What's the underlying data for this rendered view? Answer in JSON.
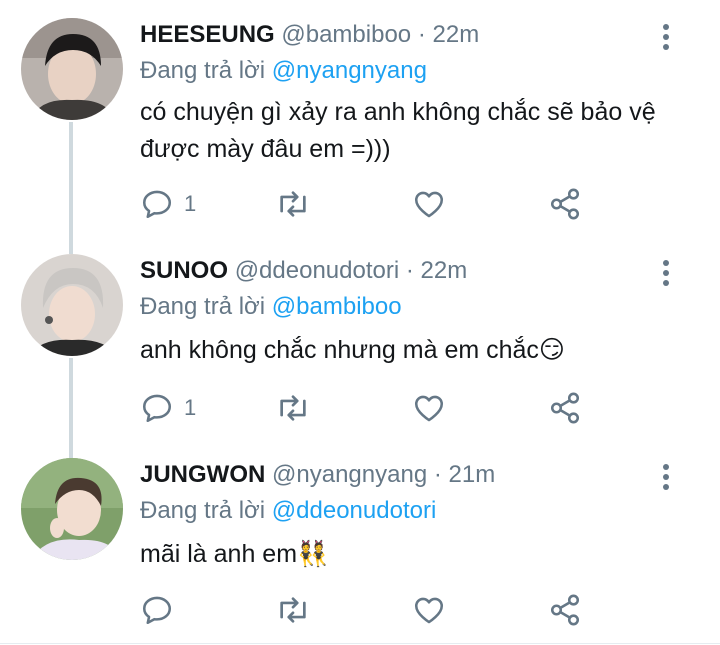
{
  "tweets": [
    {
      "name": "HEESEUNG",
      "handle": "@bambiboo",
      "time": "22m",
      "reply_prefix": "Đang trả lời",
      "reply_to": "@nyangnyang",
      "text": "có chuyện gì xảy ra anh không chắc sẽ bảo vệ được mày đâu em =)))",
      "reply_count": "1",
      "icons": [
        "reply-icon",
        "retweet-icon",
        "like-icon",
        "share-icon",
        "more-icon"
      ]
    },
    {
      "name": "SUNOO",
      "handle": "@ddeonudotori",
      "time": "22m",
      "reply_prefix": "Đang trả lời",
      "reply_to": "@bambiboo",
      "text": "anh không chắc nhưng mà em chắc😏",
      "reply_count": "1",
      "icons": [
        "reply-icon",
        "retweet-icon",
        "like-icon",
        "share-icon",
        "more-icon"
      ]
    },
    {
      "name": "JUNGWON",
      "handle": "@nyangnyang",
      "time": "21m",
      "reply_prefix": "Đang trả lời",
      "reply_to": "@ddeonudotori",
      "text": "mãi là anh em👯",
      "reply_count": "",
      "icons": [
        "reply-icon",
        "retweet-icon",
        "like-icon",
        "share-icon",
        "more-icon"
      ]
    }
  ],
  "colors": {
    "accent": "#1da1f2",
    "secondary_text": "#657786",
    "thread_line": "#cfd9de"
  }
}
